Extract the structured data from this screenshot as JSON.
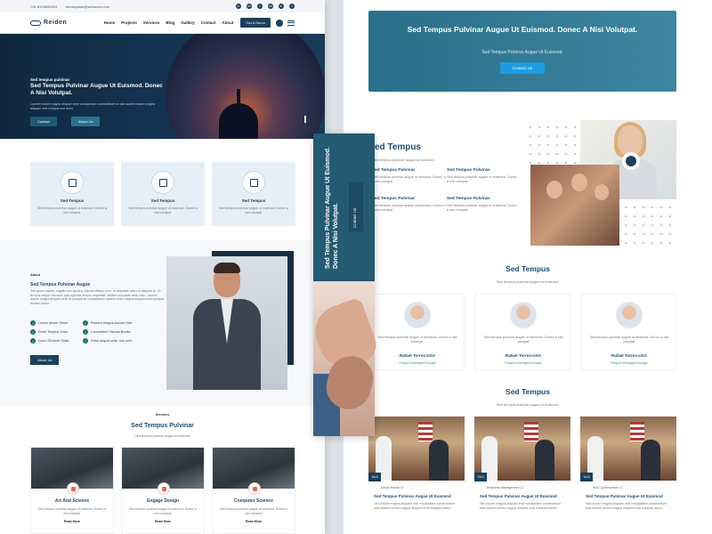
{
  "topbar": {
    "phone": "+91 8106896553",
    "email": "ibmslydeas@selwsces.com",
    "social": [
      "in",
      "tw",
      "f",
      "tw",
      "in",
      "f"
    ]
  },
  "nav": {
    "logo": "Reiden",
    "items": [
      "Home",
      "Projects",
      "Services",
      "Blog",
      "Gallery",
      "Contact",
      "About"
    ],
    "cta": "Get A Demo"
  },
  "hero": {
    "kicker": "Sed tempus pulvinar",
    "title": "Sed Tempus Pulvinar Augue Ut Euismod. Donec A Nisi Volutpat.",
    "description": "Laoreet dolore magna aliquam erat volutpat sed consectetuer ut wisi laoreet dolore magna aliquam erat volutpat sed dolor.",
    "btn_primary": "Contact",
    "btn_secondary": "About Us"
  },
  "features": [
    {
      "title": "Sed Tempus",
      "text": "Sed tempus pulvinar augue ut euismod. Donec a nisi volutpat."
    },
    {
      "title": "Sed Tempus",
      "text": "Sed tempus pulvinar augue ut euismod. Donec a nisi volutpat."
    },
    {
      "title": "Sed Tempus",
      "text": "Sed tempus pulvinar augue ut euismod. Donec a nisi volutpat."
    }
  ],
  "about": {
    "kicker": "About",
    "title": "Sed Tempus Pulvinar Augue",
    "description": "Sed quam sapien, sagittis nec ligula a, blandit efficitur sem. In vulputate tellus et aliquam et. Ut tempus neque interdum quis egestas tempor imperdiet. Nullam vulputate dolor odio. Laoreet dolore magna aliquam erat ut volutpat sit consectetuer laoreet dolor magna aliquam erat volutpat laoreet dolore.",
    "checks": [
      "Lorem Ipsum Simet",
      "Placere Magna Aucum Diet",
      "Dolor Tempus Zono",
      "Consuetum Viscula Bonita",
      "Dolor Sit Amet Suda",
      "Dolor aliquet ante, non port"
    ],
    "button": "About Us"
  },
  "services": {
    "kicker": "Services",
    "title": "Sed Tempus Pulvinar",
    "subtitle": "Sed tempus pulvinar augue ut euismod",
    "cards": [
      {
        "title": "Art And Science",
        "text": "Sed tempus pulvinar augue ut euismod. Donec a nisi volutpat.",
        "link": "Read More"
      },
      {
        "title": "Engage Design",
        "text": "Sed tempus pulvinar augue ut euismod. Donec a nisi volutpat.",
        "link": "Read More"
      },
      {
        "title": "Computer Science",
        "text": "Sed tempus pulvinar augue ut euismod. Donec a nisi volutpat.",
        "link": "Read More"
      }
    ]
  },
  "vband": {
    "title": "Sed Tempus Pulvinar Augue Ut Euismod. Donec A Nisi Volutpat.",
    "button": "Contact Us"
  },
  "cta": {
    "title": "Sed Tempus Pulvinar Augue Ut Euismod. Donec A Nisi Volutpat.",
    "subtitle": "Sed Tempus Pulvinar Augue Ut Euismod.",
    "button": "Contact Us"
  },
  "tempus": {
    "title": "ed Tempus",
    "subtitle": "ed tempus pulvinar augue ut euismod",
    "items": [
      {
        "title": "ed Tempus Pulvinar",
        "text": "ed tempus pulvinar augue ut euismod. Donec a nisi volutpat."
      },
      {
        "title": "Sed Tempus Pulvinar",
        "text": "Sed tempus pulvinar augue ut euismod. Donec a nisi volutpat."
      },
      {
        "title": "ed Tempus Pulvinar",
        "text": "ed tempus pulvinar augue ut euismod. Donec a nisi volutpat."
      },
      {
        "title": "Sed Tempus Pulvinar",
        "text": "Sed tempus pulvinar augue ut euismod. Donec a nisi volutpat."
      }
    ]
  },
  "team": {
    "title": "Sed Tempus",
    "subtitle": "Sed tempus pulvinar augue ut euismod.",
    "members": [
      {
        "text": "Sed tempus pulvinar augue ut euismod. Donec a nisi volutpat.",
        "name": "Rafael Torres-USA",
        "role": "Project Manager/Google"
      },
      {
        "text": "Sed tempus pulvinar augue ut euismod. Donec a nisi volutpat.",
        "name": "Rafael Torres-USA",
        "role": "Project Manager/Google"
      },
      {
        "text": "Sed tempus pulvinar augue ut euismod. Donec a nisi volutpat.",
        "name": "Rafael Torres-USA",
        "role": "Project Manager/Google"
      }
    ]
  },
  "blog": {
    "title": "Sed Tempus",
    "subtitle": "Sed tempus pulvinar augue ut euismod.",
    "posts": [
      {
        "date": "16/4",
        "meta": "Social Media  |  2",
        "title": "Sed Tempus Pulvinar Augue Ut Euismod",
        "text": "Sed dolore magna aliquam erat volutpatiare consectetuer erat laoreet dolore magna aliquam erat volutpat dolore."
      },
      {
        "date": "15/4",
        "meta": "Business Management  |  2",
        "title": "Sed Tempus Pulvinar Augue Ut Euismod",
        "text": "Sed dolore magna aliquam erat volutpatiare consectetuer erat laoreet dolore magna aliquam erat volutpat dolore."
      },
      {
        "date": "16/4",
        "meta": "SEO Optimization  |  2",
        "title": "Sed Tempus Pulvinar Augue Ut Euismod",
        "text": "Sed dolore magna aliquam erat volutpatiare consectetuer erat laoreet dolore magna aliquam erat volutpat dolore."
      }
    ]
  },
  "colors": {
    "primary": "#1c3f5c",
    "accent": "#245a72",
    "link_green": "#2aa36a",
    "button_blue": "#1e9be0"
  }
}
